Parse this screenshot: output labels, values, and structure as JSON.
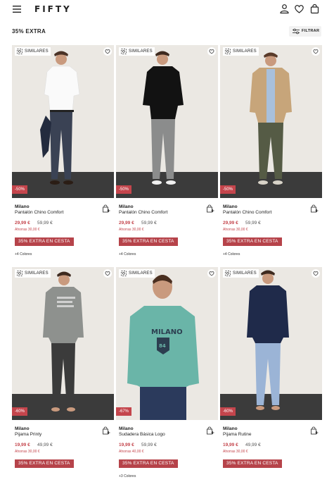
{
  "header": {
    "logo": "FIFTY",
    "icons": [
      "menu-icon",
      "user-icon",
      "heart-icon",
      "bag-icon"
    ]
  },
  "page": {
    "title": "35% EXTRA",
    "filter_label": "FILTRAR"
  },
  "common": {
    "similar_label": "SIMILARES",
    "promo_label": "35% EXTRA EN CESTA"
  },
  "products": [
    {
      "discount": "-50%",
      "brand": "Milano",
      "name": "Pantalón Chino Comfort",
      "price": "29,99 €",
      "old_price": "59,99 €",
      "savings": "Ahorras 30,00 €",
      "colors": "+4 Colores"
    },
    {
      "discount": "-50%",
      "brand": "Milano",
      "name": "Pantalón Chino Comfort",
      "price": "29,99 €",
      "old_price": "59,99 €",
      "savings": "Ahorras 30,00 €",
      "colors": "+4 Colores"
    },
    {
      "discount": "-50%",
      "brand": "Milano",
      "name": "Pantalón Chino Comfort",
      "price": "29,99 €",
      "old_price": "59,99 €",
      "savings": "Ahorras 30,00 €",
      "colors": "+4 Colores"
    },
    {
      "discount": "-60%",
      "brand": "Milano",
      "name": "Pijama Printy",
      "price": "19,99 €",
      "old_price": "49,99 €",
      "savings": "Ahorras 30,00 €",
      "colors": ""
    },
    {
      "discount": "-67%",
      "brand": "Milano",
      "name": "Sudadera Básica Logo",
      "price": "19,99 €",
      "old_price": "59,99 €",
      "savings": "Ahorras 40,00 €",
      "colors": "+3 Colores"
    },
    {
      "discount": "-60%",
      "brand": "Milano",
      "name": "Pijama Rutine",
      "price": "19,99 €",
      "old_price": "49,99 €",
      "savings": "Ahorras 30,00 €",
      "colors": ""
    }
  ],
  "colors": {
    "accent": "#c4454c",
    "promo_bg": "#b6434a",
    "photo_bg": "#ece9e4"
  }
}
